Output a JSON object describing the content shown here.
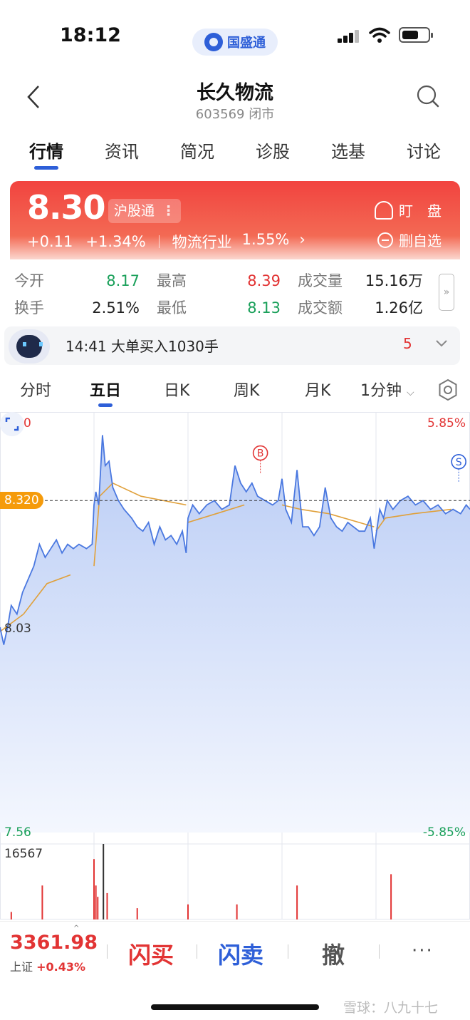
{
  "status_bar": {
    "time": "18:12",
    "brand": "国盛通"
  },
  "header": {
    "stock_name": "长久物流",
    "stock_code_status": "603569 闭市"
  },
  "tabs": [
    {
      "label": "行情",
      "active": true
    },
    {
      "label": "资讯",
      "active": false
    },
    {
      "label": "简况",
      "active": false
    },
    {
      "label": "诊股",
      "active": false
    },
    {
      "label": "选基",
      "active": false
    },
    {
      "label": "讨论",
      "active": false
    }
  ],
  "quote": {
    "price": "8.30",
    "badge": "沪股通",
    "badge_more": "⋮",
    "change": "+0.11",
    "change_pct": "+1.34%",
    "industry": "物流行业",
    "industry_pct": "1.55%",
    "industry_arrow": "›",
    "watch_label": "盯　盘",
    "remove_label": "删自选"
  },
  "stats": {
    "open_label": "今开",
    "open": "8.17",
    "high_label": "最高",
    "high": "8.39",
    "volume_label": "成交量",
    "volume": "15.16万",
    "turnover_label": "换手",
    "turnover": "2.51%",
    "low_label": "最低",
    "low": "8.13",
    "amount_label": "成交额",
    "amount": "1.26亿"
  },
  "news": {
    "text": "14:41 大单买入1030手",
    "count": "5"
  },
  "period_tabs": [
    {
      "label": "分时",
      "active": false
    },
    {
      "label": "五日",
      "active": true
    },
    {
      "label": "日K",
      "active": false
    },
    {
      "label": "周K",
      "active": false
    },
    {
      "label": "月K",
      "active": false
    },
    {
      "label": "1分钟",
      "active": false
    }
  ],
  "chart_data": {
    "type": "line",
    "title": "",
    "xlabel": "",
    "ylabel": "",
    "days": 5,
    "ylim": [
      7.56,
      8.5
    ],
    "y_labels": {
      "top": "8.50",
      "mid": "8.03",
      "bottom": "7.56"
    },
    "pct_labels": {
      "top": "5.85%",
      "bottom": "-5.85%"
    },
    "ref_line": "8.320",
    "markers": [
      {
        "label": "B",
        "x": 2.77,
        "y": 8.38
      },
      {
        "label": "S",
        "x": 4.88,
        "y": 8.36
      }
    ],
    "volume_max": "16567",
    "series": [
      {
        "values": [
          [
            0.0,
            8.03
          ],
          [
            0.04,
            7.99
          ],
          [
            0.08,
            8.03
          ],
          [
            0.12,
            8.08
          ],
          [
            0.18,
            8.06
          ],
          [
            0.24,
            8.11
          ],
          [
            0.3,
            8.14
          ],
          [
            0.36,
            8.17
          ],
          [
            0.42,
            8.22
          ],
          [
            0.48,
            8.19
          ],
          [
            0.54,
            8.21
          ],
          [
            0.6,
            8.23
          ],
          [
            0.66,
            8.2
          ],
          [
            0.72,
            8.22
          ],
          [
            0.78,
            8.21
          ],
          [
            0.84,
            8.22
          ],
          [
            0.92,
            8.21
          ],
          [
            0.98,
            8.22
          ],
          [
            1.0,
            8.31
          ],
          [
            1.02,
            8.34
          ],
          [
            1.05,
            8.31
          ],
          [
            1.09,
            8.47
          ],
          [
            1.12,
            8.4
          ],
          [
            1.16,
            8.41
          ],
          [
            1.2,
            8.35
          ],
          [
            1.26,
            8.32
          ],
          [
            1.32,
            8.3
          ],
          [
            1.4,
            8.28
          ],
          [
            1.46,
            8.26
          ],
          [
            1.52,
            8.25
          ],
          [
            1.58,
            8.27
          ],
          [
            1.64,
            8.22
          ],
          [
            1.7,
            8.26
          ],
          [
            1.76,
            8.23
          ],
          [
            1.82,
            8.24
          ],
          [
            1.88,
            8.22
          ],
          [
            1.94,
            8.25
          ],
          [
            1.98,
            8.2
          ],
          [
            2.0,
            8.28
          ],
          [
            2.05,
            8.31
          ],
          [
            2.12,
            8.29
          ],
          [
            2.2,
            8.31
          ],
          [
            2.28,
            8.32
          ],
          [
            2.36,
            8.3
          ],
          [
            2.44,
            8.31
          ],
          [
            2.5,
            8.4
          ],
          [
            2.56,
            8.36
          ],
          [
            2.62,
            8.34
          ],
          [
            2.68,
            8.36
          ],
          [
            2.74,
            8.33
          ],
          [
            2.82,
            8.32
          ],
          [
            2.9,
            8.31
          ],
          [
            2.96,
            8.32
          ],
          [
            3.0,
            8.37
          ],
          [
            3.04,
            8.3
          ],
          [
            3.1,
            8.27
          ],
          [
            3.16,
            8.39
          ],
          [
            3.22,
            8.26
          ],
          [
            3.28,
            8.26
          ],
          [
            3.34,
            8.24
          ],
          [
            3.4,
            8.26
          ],
          [
            3.46,
            8.35
          ],
          [
            3.52,
            8.28
          ],
          [
            3.58,
            8.26
          ],
          [
            3.64,
            8.25
          ],
          [
            3.7,
            8.27
          ],
          [
            3.76,
            8.26
          ],
          [
            3.82,
            8.25
          ],
          [
            3.88,
            8.25
          ],
          [
            3.94,
            8.28
          ],
          [
            3.98,
            8.21
          ],
          [
            4.0,
            8.24
          ],
          [
            4.04,
            8.3
          ],
          [
            4.08,
            8.28
          ],
          [
            4.12,
            8.32
          ],
          [
            4.18,
            8.3
          ],
          [
            4.26,
            8.32
          ],
          [
            4.34,
            8.33
          ],
          [
            4.42,
            8.31
          ],
          [
            4.5,
            8.32
          ],
          [
            4.58,
            8.3
          ],
          [
            4.66,
            8.31
          ],
          [
            4.74,
            8.29
          ],
          [
            4.82,
            8.3
          ],
          [
            4.9,
            8.29
          ],
          [
            4.96,
            8.31
          ],
          [
            5.0,
            8.3
          ]
        ]
      },
      {
        "values": [
          [
            0.0,
            8.02
          ],
          [
            0.25,
            8.06
          ],
          [
            0.5,
            8.13
          ],
          [
            0.75,
            8.15
          ],
          [
            1.0,
            8.17
          ],
          [
            1.06,
            8.33
          ],
          [
            1.2,
            8.36
          ],
          [
            1.5,
            8.33
          ],
          [
            1.98,
            8.31
          ],
          [
            2.0,
            8.27
          ],
          [
            2.3,
            8.29
          ],
          [
            2.6,
            8.31
          ],
          [
            3.0,
            8.31
          ],
          [
            3.2,
            8.3
          ],
          [
            3.5,
            8.29
          ],
          [
            3.98,
            8.26
          ],
          [
            4.0,
            8.25
          ],
          [
            4.1,
            8.28
          ],
          [
            4.4,
            8.29
          ],
          [
            4.8,
            8.3
          ],
          [
            5.0,
            8.3
          ]
        ]
      }
    ],
    "volume_bars": [
      [
        0.12,
        0.1
      ],
      [
        0.45,
        0.45
      ],
      [
        1.0,
        0.8
      ],
      [
        1.02,
        0.45
      ],
      [
        1.04,
        0.3
      ],
      [
        1.1,
        1.0
      ],
      [
        1.14,
        0.35
      ],
      [
        1.46,
        0.15
      ],
      [
        2.0,
        0.2
      ],
      [
        2.52,
        0.2
      ],
      [
        3.16,
        0.45
      ],
      [
        4.16,
        0.6
      ]
    ]
  },
  "bottom_bar": {
    "index_value": "3361.98",
    "index_name": "上证",
    "index_change": "+0.43%",
    "caret": "^",
    "buy": "闪买",
    "sell": "闪卖",
    "cancel": "撤",
    "more": "···",
    "watermark": "雪球：八九十七"
  },
  "colors": {
    "up": "#e23434",
    "down": "#1aa05a",
    "line": "#4a78e0",
    "avg_line": "#e0a03a",
    "accent": "#2e5fd8",
    "ref_tag": "#f59b0b"
  }
}
